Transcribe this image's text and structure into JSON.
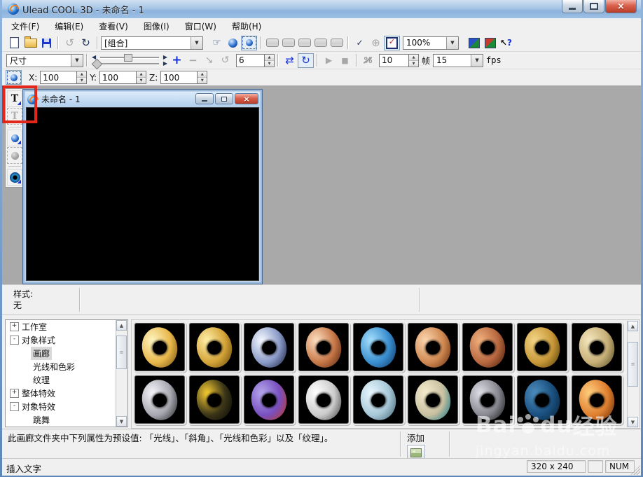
{
  "window": {
    "title": "Ulead COOL 3D - 未命名 - 1"
  },
  "menu": {
    "items": [
      "文件(F)",
      "编辑(E)",
      "查看(V)",
      "图像(I)",
      "窗口(W)",
      "帮助(H)"
    ]
  },
  "toolbar_standard": {
    "group_combo": "[组合]",
    "zoom_combo": "100%"
  },
  "toolbar_animation": {
    "attr_combo": "尺寸",
    "key_value": "6",
    "frame_value": "10",
    "frame_label": "帧",
    "fps_value": "15",
    "fps_label": "fps"
  },
  "toolbar_position": {
    "x_label": "X:",
    "x_value": "100",
    "y_label": "Y:",
    "y_value": "100",
    "z_label": "Z:",
    "z_value": "100"
  },
  "document": {
    "title": "未命名 - 1"
  },
  "style_bar": {
    "label": "样式:",
    "value": "无"
  },
  "tree": {
    "items": [
      {
        "sign": "+",
        "label": "工作室"
      },
      {
        "sign": "-",
        "label": "对象样式"
      },
      {
        "sign": "",
        "label": "画廊"
      },
      {
        "sign": "",
        "label": "光线和色彩"
      },
      {
        "sign": "",
        "label": "纹理"
      },
      {
        "sign": "+",
        "label": "整体特效"
      },
      {
        "sign": "-",
        "label": "对象特效"
      },
      {
        "sign": "",
        "label": "跳舞"
      }
    ]
  },
  "gallery": {
    "items": [
      {
        "name": "gold-smooth-torus",
        "hi": "#fcf0b8",
        "body": "#e8b84b",
        "dk": "#7a5410"
      },
      {
        "name": "gold-ringed-torus",
        "hi": "#fce9a0",
        "body": "#d4a437",
        "dk": "#6a4a0c"
      },
      {
        "name": "steel-blue-torus",
        "hi": "#eef2fc",
        "body": "#8a9ac8",
        "dk": "#1a2440"
      },
      {
        "name": "copper-shiny-torus",
        "hi": "#f8d8b8",
        "body": "#c87848",
        "dk": "#5a2810"
      },
      {
        "name": "blue-water-torus",
        "hi": "#9cd8f8",
        "body": "#3a8fd0",
        "dk": "#103a68"
      },
      {
        "name": "copper-ringed-torus",
        "hi": "#f8d0a8",
        "body": "#d08850",
        "dk": "#6a3414"
      },
      {
        "name": "copper-carved-torus",
        "hi": "#ecaa78",
        "body": "#b86840",
        "dk": "#4a2008"
      },
      {
        "name": "gold-carved-torus",
        "hi": "#f0d080",
        "body": "#c89838",
        "dk": "#584008"
      },
      {
        "name": "tan-scales-torus",
        "hi": "#f0e2b8",
        "body": "#c8b078",
        "dk": "#585028"
      },
      {
        "name": "silver-slotted-torus",
        "hi": "#eeeef4",
        "body": "#a8a8b0",
        "dk": "#2a2a30"
      },
      {
        "name": "leopard-spots-torus",
        "hi": "#e8c030",
        "body": "#3a3418",
        "dk": "#0a0a04"
      },
      {
        "name": "color-patches-torus",
        "hi": "#b0a0e8",
        "body": "#7850c0",
        "dk": "#c03828"
      },
      {
        "name": "white-marble-torus",
        "hi": "#fcfcfc",
        "body": "#cccccc",
        "dk": "#4a4a4a"
      },
      {
        "name": "pale-blue-torus",
        "hi": "#e4f4fc",
        "body": "#a8c8d8",
        "dk": "#486878"
      },
      {
        "name": "cream-teal-swirl-torus",
        "hi": "#f0e8c8",
        "body": "#c8c0a0",
        "dk": "#1a7888"
      },
      {
        "name": "steel-flange-torus",
        "hi": "#d8d8e0",
        "body": "#888890",
        "dk": "#1c1c22"
      },
      {
        "name": "denim-blue-torus",
        "hi": "#4888b8",
        "body": "#1a5080",
        "dk": "#082438"
      },
      {
        "name": "orange-smooth-torus",
        "hi": "#fcc878",
        "body": "#e08030",
        "dk": "#6a3008"
      }
    ]
  },
  "info_bar": {
    "text": "此画廊文件夹中下列属性为预设值: 「光线」、「斜角」、「光线和色彩」以及「纹理」。",
    "add_label": "添加"
  },
  "status_bar": {
    "message": "插入文字",
    "canvas_size": "320 x 240",
    "num_lock": "NUM"
  },
  "watermark": {
    "brand_left": "Bai",
    "brand_right": "du",
    "brand_suffix": "经验",
    "url": "jingyan.baidu.com"
  },
  "annotation": {
    "color": "#e3261a"
  }
}
